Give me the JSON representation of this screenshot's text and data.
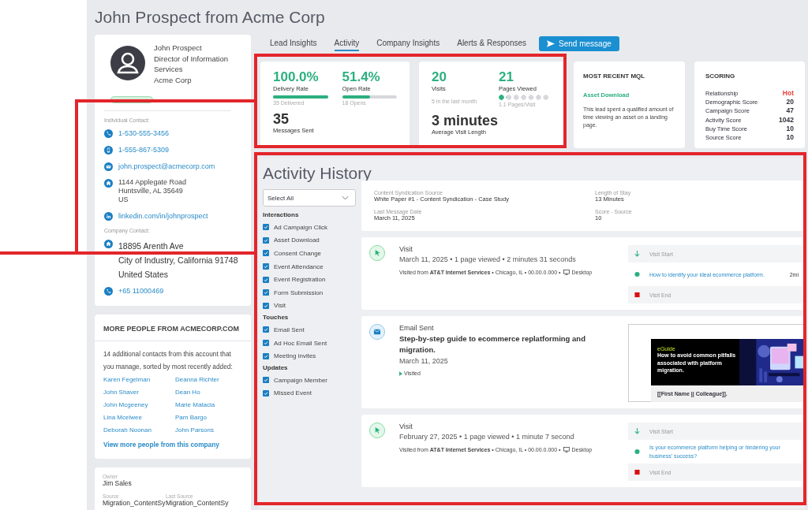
{
  "page": {
    "title": "John Prospect from Acme Corp"
  },
  "profile": {
    "name": "John Prospect",
    "job_title": "Director of Information Services",
    "company": "Acme Corp",
    "individual_contact": {
      "label": "Individual Contact:",
      "items": [
        {
          "kind": "phone",
          "text": "1-530-555-3456"
        },
        {
          "kind": "mobile",
          "text": "1-555-867-5309"
        },
        {
          "kind": "email",
          "text": "john.prospect@acmecorp.com"
        },
        {
          "kind": "address",
          "lines": [
            "1144 Applegate Road",
            "Huntsville, AL 35649",
            "US"
          ]
        },
        {
          "kind": "linkedin",
          "text": "linkedin.com/in/johnprospect"
        }
      ]
    },
    "company_contact": {
      "label": "Company Contact:",
      "items": [
        {
          "kind": "address",
          "lines": [
            "18895 Arenth Ave",
            "City of Industry, California 91748",
            "United States"
          ]
        },
        {
          "kind": "phone",
          "text": "+65 11000469"
        }
      ]
    }
  },
  "more_people": {
    "title": "MORE PEOPLE FROM ACMECORP.COM",
    "description": "14 additional contacts from this account that you manage, sorted by most recently added:",
    "people": [
      "Karen Fegelman",
      "Deanna Richter",
      "John Shaver",
      "Dean Ho",
      "John Mcgeeney",
      "Marie Matacia",
      "Lina Mcelwee",
      "Pam Bargo",
      "Deborah Noonan",
      "John Parsons"
    ],
    "link": "View more people from this company"
  },
  "owner_card": {
    "owner": {
      "label": "Owner",
      "value": "Jim Sales"
    },
    "sources": [
      {
        "label": "Source",
        "value": "Migration_ContentSy"
      },
      {
        "label": "Last Source",
        "value": "Migration_ContentSy"
      }
    ]
  },
  "tabs": [
    {
      "label": "Lead Insights",
      "selected": false
    },
    {
      "label": "Activity",
      "selected": true
    },
    {
      "label": "Company Insights",
      "selected": false
    },
    {
      "label": "Alerts & Responses",
      "selected": false
    }
  ],
  "send_button": {
    "label": "Send message"
  },
  "email_metrics": {
    "rates": [
      {
        "value": "100.0%",
        "label": "Delivery Rate",
        "level": 1.0,
        "note": "35 Delivered"
      },
      {
        "value": "51.4%",
        "label": "Open Rate",
        "level": 0.514,
        "note": "18 Opens"
      }
    ],
    "total": {
      "value": "35",
      "label": "Messages Sent"
    }
  },
  "visit_metrics": {
    "visits": {
      "value": "20",
      "label": "Visits",
      "note": "5 in the last month"
    },
    "pages": {
      "value": "21",
      "label": "Pages Viewed",
      "level": 0.157,
      "note": "1.1 Pages/Visit"
    },
    "average": {
      "value": "3 minutes",
      "label": "Average Visit Length"
    }
  },
  "mql": {
    "title": "MOST RECENT MQL",
    "name": "Asset Download",
    "description": "This lead spent a qualified amount of time viewing an asset on a landing page."
  },
  "scoring": {
    "title": "SCORING",
    "rows": [
      {
        "label": "Relationship",
        "value": "Hot",
        "color": "#e8413c"
      },
      {
        "label": "Demographic Score",
        "value": "20",
        "color": "#2f2f3a"
      },
      {
        "label": "Campaign Score",
        "value": "47",
        "color": "#2f2f3a"
      },
      {
        "label": "Activity Score",
        "value": "1042",
        "color": "#2f2f3a"
      },
      {
        "label": "Buy Time Score",
        "value": "10",
        "color": "#2f2f3a"
      },
      {
        "label": "Source Score",
        "value": "10",
        "color": "#2f2f3a"
      }
    ]
  },
  "activity_history": {
    "title": "Activity History",
    "filter": {
      "value": "Select All"
    },
    "filter_groups": [
      {
        "title": "Interactions",
        "items": [
          {
            "label": "Ad Campaign Click",
            "checked": true
          },
          {
            "label": "Asset Download",
            "checked": true
          },
          {
            "label": "Consent Change",
            "checked": true
          },
          {
            "label": "Event Attendance",
            "checked": true
          },
          {
            "label": "Event Registration",
            "checked": true
          },
          {
            "label": "Form Submission",
            "checked": true
          },
          {
            "label": "Visit",
            "checked": true
          }
        ]
      },
      {
        "title": "Touches",
        "items": [
          {
            "label": "Email Sent",
            "checked": true
          },
          {
            "label": "Ad Hoc Email Sent",
            "checked": true
          },
          {
            "label": "Meeting invites",
            "checked": true
          }
        ]
      },
      {
        "title": "Updates",
        "items": [
          {
            "label": "Campaign Member",
            "checked": true
          },
          {
            "label": "Missed Event",
            "checked": true
          }
        ]
      }
    ],
    "summary": {
      "fields": [
        {
          "label": "Content Syndication Source",
          "value": "White Paper #1 - Content Syndication - Case Study"
        },
        {
          "label": "Length of Stay",
          "value": "13 Minutes"
        },
        {
          "label": "Last Message Date",
          "value": "March 11, 2025"
        },
        {
          "label": "Score - Source",
          "value": "10"
        }
      ]
    },
    "events": [
      {
        "kind": "visit",
        "title": "Visit",
        "summary": "March 11, 2025 • 1 page viewed • 2 minutes 31 seconds",
        "origin": "Visited from **AT&T Internet Services** • Chicago, IL • 00.00.0.000 •",
        "device": "Desktop",
        "steps": [
          {
            "kind": "start",
            "label": "Visit Start"
          },
          {
            "kind": "page",
            "label": "How to identify your ideal ecommerce platform.",
            "duration": "2mi"
          },
          {
            "kind": "end",
            "label": "Visit End"
          }
        ]
      },
      {
        "kind": "email",
        "title": "Email Sent",
        "subject": "Step-by-step guide to ecommerce replatforming and migration.",
        "date": "March 11, 2025",
        "status": "Visited",
        "preview": {
          "tag": "eGuide",
          "headline": "How to avoid common pitfalls associated with platform migration.",
          "greeting": "[[First Name || Colleague]]."
        }
      },
      {
        "kind": "visit",
        "title": "Visit",
        "summary": "February 27, 2025 • 1 page viewed • 1 minute 7 second",
        "origin": "Visited from **AT&T Internet Services** • Chicago, IL • 00.00.0.000 •",
        "device": "Desktop",
        "steps": [
          {
            "kind": "start",
            "label": "Visit Start"
          },
          {
            "kind": "page",
            "label": "Is your ecommerce platform helping or hindering your business' success?"
          },
          {
            "kind": "end",
            "label": "Visit End"
          }
        ]
      }
    ]
  }
}
